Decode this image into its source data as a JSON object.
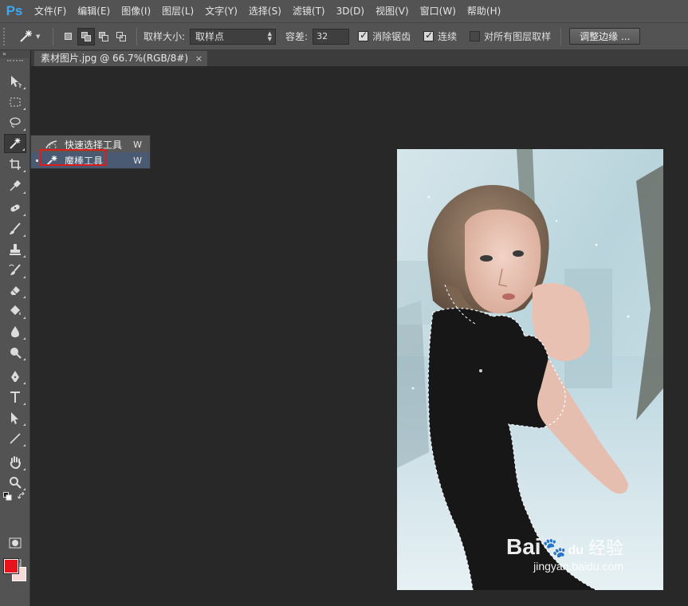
{
  "app": {
    "logo": "Ps",
    "menu": [
      "文件(F)",
      "编辑(E)",
      "图像(I)",
      "图层(L)",
      "文字(Y)",
      "选择(S)",
      "滤镜(T)",
      "3D(D)",
      "视图(V)",
      "窗口(W)",
      "帮助(H)"
    ]
  },
  "options": {
    "sample_size_label": "取样大小:",
    "sample_size_value": "取样点",
    "tolerance_label": "容差:",
    "tolerance_value": "32",
    "antialias_label": "消除锯齿",
    "antialias_checked": true,
    "contiguous_label": "连续",
    "contiguous_checked": true,
    "sample_all_layers_label": "对所有图层取样",
    "sample_all_layers_checked": false,
    "refine_edge_label": "调整边缘 ..."
  },
  "document": {
    "tab_title": "素材图片.jpg @ 66.7%(RGB/8#)",
    "close_glyph": "×"
  },
  "flyout": {
    "items": [
      {
        "label": "快速选择工具",
        "shortcut": "W",
        "icon": "quick-selection-icon",
        "selected": false
      },
      {
        "label": "魔棒工具",
        "shortcut": "W",
        "icon": "magic-wand-icon",
        "selected": true
      }
    ]
  },
  "colors": {
    "foreground": "#e8141c",
    "background": "#f8d9d9",
    "highlight_box": "#e01b1b",
    "logo_blue": "#3ea8f4"
  },
  "watermark": {
    "brand": "Bai",
    "brand_suffix": "du",
    "brand_cn": "经验",
    "url": "jingyan.baidu.com"
  }
}
